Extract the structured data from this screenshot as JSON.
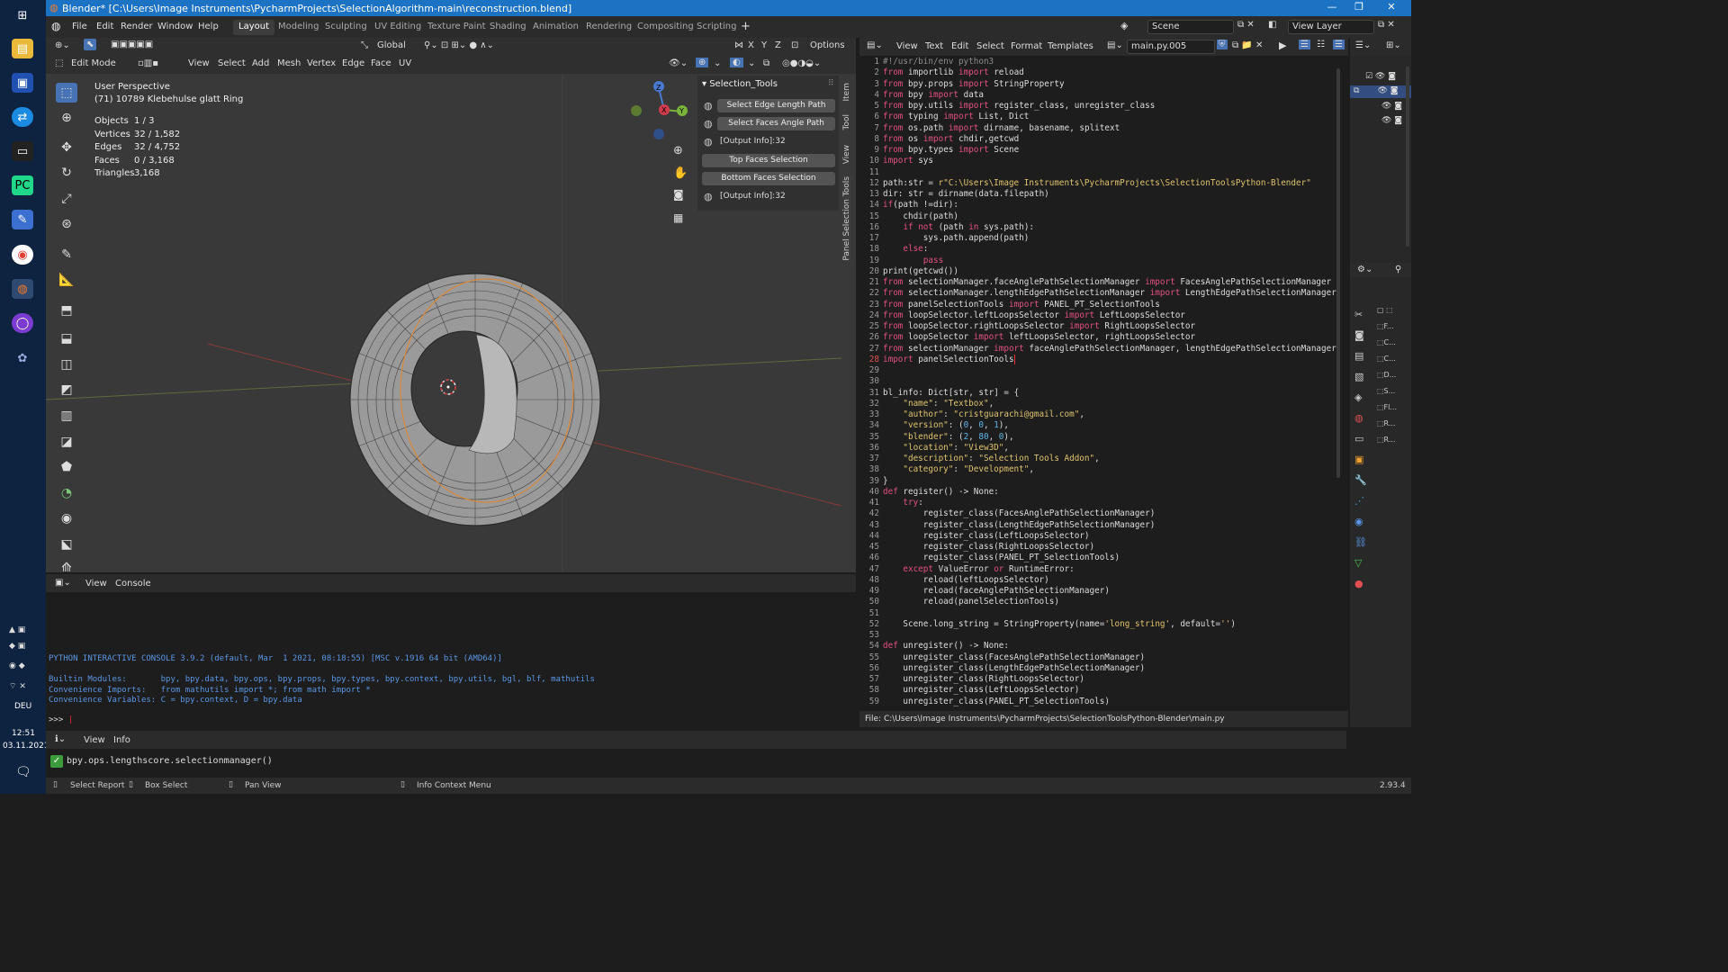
{
  "window": {
    "title": "Blender* [C:\\Users\\Image Instruments\\PycharmProjects\\SelectionAlgorithm-main\\reconstruction.blend]",
    "minimize": "—",
    "maximize": "❐",
    "close": "✕"
  },
  "taskbar": {
    "time": "12:51",
    "date": "03.11.2021",
    "lang": "DEU"
  },
  "menu": {
    "file": "File",
    "edit": "Edit",
    "render": "Render",
    "window": "Window",
    "help": "Help"
  },
  "workspaces": [
    "Layout",
    "Modeling",
    "Sculpting",
    "UV Editing",
    "Texture Paint",
    "Shading",
    "Animation",
    "Rendering",
    "Compositing",
    "Scripting"
  ],
  "scene": {
    "name": "Scene",
    "view_layer": "View Layer"
  },
  "viewport": {
    "transform": "Global",
    "options": "Options",
    "axes": [
      "X",
      "Y",
      "Z"
    ],
    "mode": "Edit Mode",
    "menus": [
      "View",
      "Select",
      "Add",
      "Mesh",
      "Vertex",
      "Edge",
      "Face",
      "UV"
    ],
    "perspective": "User Perspective",
    "object_name": "(71) 10789 Klebehulse glatt Ring",
    "stats": [
      {
        "label": "Objects",
        "value": "1 / 3"
      },
      {
        "label": "Vertices",
        "value": "32 / 1,582"
      },
      {
        "label": "Edges",
        "value": "32 / 4,752"
      },
      {
        "label": "Faces",
        "value": "0 / 3,168"
      },
      {
        "label": "Triangles",
        "value": "3,168"
      }
    ],
    "gizmo": {
      "x": "X",
      "y": "Y",
      "z": "Z"
    }
  },
  "npanel": {
    "title": "Selection_Tools",
    "btn_edge": "Select Edge Length Path",
    "btn_faces": "Select Faces Angle Path",
    "output1": "[Output Info]:32",
    "btn_top": "Top Faces Selection",
    "btn_bottom": "Bottom Faces Selection",
    "output2": "[Output Info]:32",
    "tabs": [
      "Item",
      "Tool",
      "View",
      "Panel Selection Tools"
    ]
  },
  "text_editor": {
    "menus": [
      "View",
      "Text",
      "Edit",
      "Select",
      "Format",
      "Templates"
    ],
    "filename": "main.py.005",
    "footer": "File: C:\\Users\\Image Instruments\\PycharmProjects\\SelectionToolsPython-Blender\\main.py"
  },
  "console": {
    "menus": [
      "View",
      "Console"
    ],
    "version_line": "PYTHON INTERACTIVE CONSOLE 3.9.2 (default, Mar  1 2021, 08:18:55) [MSC v.1916 64 bit (AMD64)]",
    "builtin": "Builtin Modules:       bpy, bpy.data, bpy.ops, bpy.props, bpy.types, bpy.context, bpy.utils, bgl, blf, mathutils",
    "imports": "Convenience Imports:   from mathutils import *; from math import *",
    "variables": "Convenience Variables: C = bpy.context, D = bpy.data",
    "prompt": ">>> "
  },
  "info": {
    "menus": [
      "View",
      "Info"
    ],
    "report": "bpy.ops.lengthscore.selectionmanager()"
  },
  "status": {
    "select_report": "Select Report",
    "box_select": "Box Select",
    "pan_view": "Pan View",
    "context_menu": "Info Context Menu",
    "version": "2.93.4"
  },
  "code": [
    "#!/usr/bin/env python3",
    "from importlib import reload",
    "from bpy.props import StringProperty",
    "from bpy import data",
    "from bpy.utils import register_class, unregister_class",
    "from typing import List, Dict",
    "from os.path import dirname, basename, splitext",
    "from os import chdir,getcwd",
    "from bpy.types import Scene",
    "import sys",
    "",
    "path:str = r\"C:\\Users\\Image Instruments\\PycharmProjects\\SelectionToolsPython-Blender\"",
    "dir: str = dirname(data.filepath)",
    "if(path !=dir):",
    "    chdir(path)",
    "    if not (path in sys.path):",
    "        sys.path.append(path)",
    "    else:",
    "        pass",
    "print(getcwd())",
    "from selectionManager.faceAnglePathSelectionManager import FacesAnglePathSelectionManager",
    "from selectionManager.lengthEdgePathSelectionManager import LengthEdgePathSelectionManager",
    "from panelSelectionTools import PANEL_PT_SelectionTools",
    "from loopSelector.leftLoopsSelector import LeftLoopsSelector",
    "from loopSelector.rightLoopsSelector import RightLoopsSelector",
    "from loopSelector import leftLoopsSelector, rightLoopsSelector",
    "from selectionManager import faceAnglePathSelectionManager, lengthEdgePathSelectionManager",
    "import panelSelectionTools",
    "",
    "",
    "bl_info: Dict[str, str] = {",
    "    \"name\": \"Textbox\",",
    "    \"author\": \"cristguarachi@gmail.com\",",
    "    \"version\": (0, 0, 1),",
    "    \"blender\": (2, 80, 0),",
    "    \"location\": \"View3D\",",
    "    \"description\": \"Selection Tools Addon\",",
    "    \"category\": \"Development\",",
    "}",
    "def register() -> None:",
    "    try:",
    "        register_class(FacesAnglePathSelectionManager)",
    "        register_class(LengthEdgePathSelectionManager)",
    "        register_class(LeftLoopsSelector)",
    "        register_class(RightLoopsSelector)",
    "        register_class(PANEL_PT_SelectionTools)",
    "    except ValueError or RuntimeError:",
    "        reload(leftLoopsSelector)",
    "        reload(faceAnglePathSelectionManager)",
    "        reload(panelSelectionTools)",
    "",
    "    Scene.long_string = StringProperty(name='long_string', default='')",
    "",
    "def unregister() -> None:",
    "    unregister_class(FacesAnglePathSelectionManager)",
    "    unregister_class(LengthEdgePathSelectionManager)",
    "    unregister_class(RightLoopsSelector)",
    "    unregister_class(LeftLoopsSelector)",
    "    unregister_class(PANEL_PT_SelectionTools)"
  ]
}
